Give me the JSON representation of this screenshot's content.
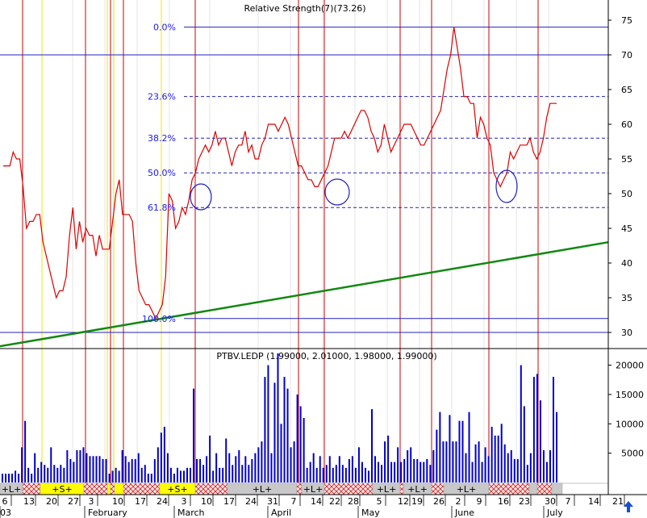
{
  "chart_data": [
    {
      "type": "line",
      "title": "Relative Strength(7)(73.26)",
      "y_axis_position": "right",
      "ylim": [
        27.5,
        77.5
      ],
      "y_ticks": [
        30,
        35,
        40,
        45,
        50,
        55,
        60,
        65,
        70,
        75
      ],
      "series": [
        {
          "name": "",
          "color": "#dd0000",
          "values": [
            54,
            54,
            54,
            56,
            55,
            55,
            51,
            45,
            46,
            46,
            47,
            47,
            43,
            41,
            39,
            37,
            35,
            36,
            36,
            38,
            44,
            48,
            42,
            46,
            43,
            45,
            44,
            44,
            41,
            44,
            42,
            42,
            42,
            46,
            50,
            52,
            47,
            47,
            47,
            46,
            40,
            36,
            35,
            34,
            34,
            33,
            32,
            33,
            34,
            38,
            50,
            49,
            45,
            46,
            48,
            47,
            49,
            52,
            53,
            55,
            56,
            57,
            56,
            57,
            59,
            57,
            58,
            58,
            56,
            54,
            56,
            57,
            57,
            59,
            56,
            57,
            55,
            55,
            57,
            58,
            60,
            60,
            60,
            59,
            60,
            61,
            60,
            58,
            56,
            54,
            54,
            53,
            52,
            52,
            51,
            51,
            52,
            53,
            54,
            56,
            58,
            58,
            58,
            59,
            58,
            59,
            60,
            61,
            62,
            62,
            61,
            59,
            58,
            56,
            57,
            60,
            58,
            56,
            57,
            58,
            59,
            60,
            60,
            60,
            59,
            58,
            57,
            57,
            58,
            59,
            60,
            61,
            62,
            65,
            68,
            70,
            74,
            71,
            68,
            64,
            64,
            63,
            63,
            58,
            61,
            60,
            58,
            57,
            53,
            52,
            51,
            52,
            53,
            56,
            55,
            56,
            57,
            57,
            57,
            58,
            56,
            55,
            56,
            58,
            61,
            63,
            63,
            63
          ]
        }
      ],
      "annotations": {
        "fib_levels": [
          {
            "label": "0.0%",
            "value": 74
          },
          {
            "label": "23.6%",
            "value": 64
          },
          {
            "label": "38.2%",
            "value": 58
          },
          {
            "label": "50.0%",
            "value": 53
          },
          {
            "label": "61.8%",
            "value": 48
          },
          {
            "label": "100.0%",
            "value": 32
          }
        ],
        "horizontal_lines": [
          70,
          30
        ],
        "trendline": {
          "color": "#118811",
          "start_value": 28,
          "end_value": 43
        }
      }
    },
    {
      "type": "bar",
      "title": "PTBV.LEDP (1.99000, 2.01000, 1.98000, 1.99000)",
      "y_axis_position": "right",
      "ylim": [
        0,
        22000
      ],
      "y_ticks": [
        5000,
        10000,
        15000,
        20000
      ],
      "series": [
        {
          "name": "",
          "color": "#0000cc",
          "values": [
            1500,
            1500,
            1500,
            1500,
            2000,
            1500,
            6000,
            10500,
            2500,
            1500,
            5000,
            2500,
            3500,
            3000,
            2500,
            6000,
            3000,
            2500,
            3000,
            2500,
            5500,
            4000,
            3500,
            5500,
            5500,
            6000,
            5000,
            4500,
            4500,
            4500,
            4500,
            4000,
            4000,
            1500,
            2000,
            2500,
            2000,
            5500,
            4500,
            3500,
            4000,
            4000,
            5000,
            2500,
            3000,
            1500,
            1500,
            4000,
            6000,
            8500,
            9500,
            5000,
            2500,
            1500,
            2500,
            2000,
            2000,
            2500,
            2500,
            16000,
            4000,
            4000,
            3000,
            4500,
            8000,
            2000,
            5000,
            2500,
            2500,
            7500,
            5000,
            3000,
            4500,
            5500,
            3000,
            4500,
            3000,
            4000,
            5000,
            6000,
            7000,
            18000,
            20000,
            5000,
            17000,
            22000,
            10000,
            18000,
            16000,
            6000,
            7000,
            15000,
            13000,
            11000,
            2500,
            3500,
            5000,
            2500,
            4500,
            2500,
            3000,
            4500,
            2500,
            3000,
            4500,
            3000,
            2500,
            4000,
            4500,
            2500,
            6000,
            3500,
            2500,
            2000,
            12500,
            4500,
            3500,
            3000,
            7000,
            8000,
            3500,
            3500,
            6000,
            3500,
            4000,
            5500,
            6000,
            4000,
            4000,
            3500,
            3500,
            4000,
            3000,
            5500,
            9000,
            12000,
            7000,
            7000,
            11500,
            7000,
            7000,
            10500,
            10500,
            5000,
            12000,
            3500,
            6500,
            7000,
            3500,
            6000,
            4500,
            9500,
            8000,
            8000,
            10000,
            6500,
            5000,
            5500,
            4000,
            4000,
            20000,
            13000,
            3000,
            5000,
            18000,
            18500,
            14000,
            5500,
            3500,
            5500,
            18000,
            12000
          ]
        }
      ],
      "annotations": {
        "signal_strip": {
          "labels": [
            "+L+",
            "+S+",
            "+S+",
            "+L+",
            "+L+",
            "+L+",
            "+L+",
            "+L+"
          ]
        }
      }
    }
  ],
  "x_axis": {
    "day_ticks": [
      "6",
      "13",
      "20",
      "27",
      "3",
      "10",
      "17",
      "24",
      "3",
      "10",
      "17",
      "24",
      "31",
      "7",
      "14",
      "22",
      "28",
      "5",
      "12",
      "19",
      "26",
      "2",
      "9",
      "16",
      "23",
      "30",
      "7",
      "14",
      "21"
    ],
    "month_labels": [
      "03",
      "February",
      "March",
      "April",
      "May",
      "June",
      "July"
    ]
  },
  "nav": {
    "scroll_arrow": "up-arrow-icon"
  }
}
